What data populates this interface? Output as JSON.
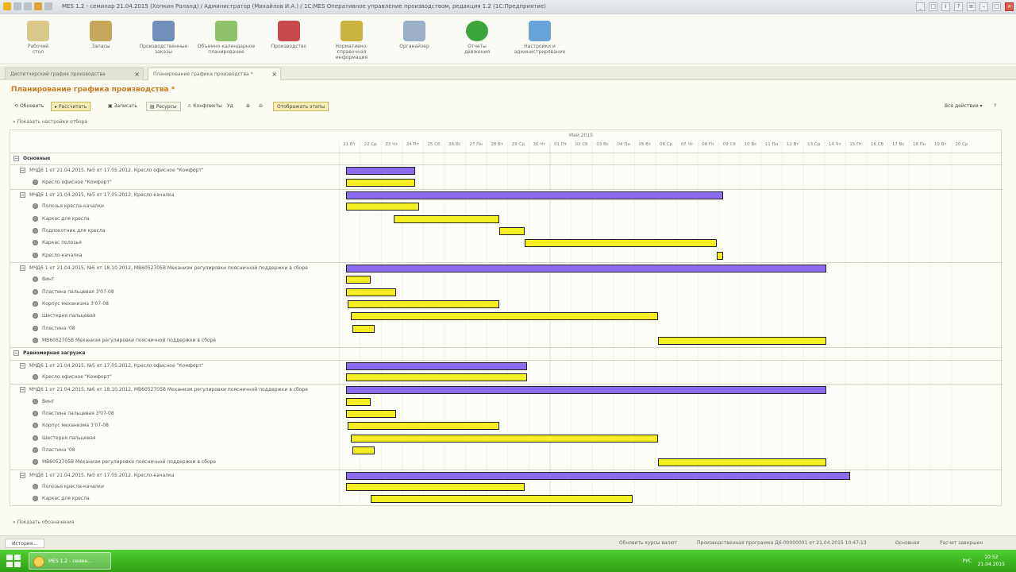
{
  "window": {
    "title": "MES 1.2 - семинар 21.04.2015 (Хопкин Роланд) / Администратор (Михайлов И.А.) / 1С:MES Оперативное управление производством, редакция 1.2 (1С:Предприятие)"
  },
  "ribbon": {
    "items": [
      {
        "label1": "Рабочий",
        "label2": "стол",
        "icon": "desktop-icon"
      },
      {
        "label1": "Запасы",
        "label2": "",
        "icon": "stock-icon"
      },
      {
        "label1": "Производственные",
        "label2": "заказы",
        "icon": "orders-icon"
      },
      {
        "label1": "Объемно-календарное",
        "label2": "планирование",
        "icon": "planning-icon"
      },
      {
        "label1": "Производство",
        "label2": "",
        "icon": "production-icon"
      },
      {
        "label1": "Нормативно-справочная",
        "label2": "информация",
        "icon": "reference-icon"
      },
      {
        "label1": "Органайзер",
        "label2": "",
        "icon": "organizer-icon"
      },
      {
        "label1": "Отчеты",
        "label2": "движения",
        "icon": "reports-icon"
      },
      {
        "label1": "Настройки и",
        "label2": "администрирование",
        "icon": "settings-icon"
      }
    ]
  },
  "tabs": [
    {
      "label": "Диспетчерский график производства",
      "active": false
    },
    {
      "label": "Планирование графика производства *",
      "active": true
    }
  ],
  "page": {
    "title": "Планирование графика производства *",
    "settings_link": "Показать настройки отбора",
    "bottom_link": "Показать обозначения"
  },
  "toolbar": {
    "refresh": "Обновить",
    "calculate": "Рассчитать",
    "save": "Записать",
    "resources": "Ресурсы",
    "conflicts": "Конфликты",
    "depth": "Уд",
    "show_stages": "Отображать этапы",
    "all_actions": "Все действия"
  },
  "timeline": {
    "month": "Май 2015",
    "days": [
      "21 Вт",
      "22 Ср",
      "23 Чт",
      "24 Пт",
      "25 Сб",
      "26 Вс",
      "27 Пн",
      "28 Вт",
      "29 Ср",
      "30 Чт",
      "01 Пт",
      "02 Сб",
      "03 Вс",
      "04 Пн",
      "05 Вт",
      "06 Ср",
      "07 Чт",
      "08 Пт",
      "09 Сб",
      "10 Вс",
      "11 Пн",
      "12 Вт",
      "13 Ср",
      "14 Чт",
      "15 Пт",
      "16 Сб",
      "17 Вс",
      "18 Пн",
      "19 Вт",
      "20 Ср"
    ]
  },
  "rows": [
    {
      "level": 0,
      "kind": "group",
      "label": "Основные",
      "bar": null
    },
    {
      "level": 1,
      "kind": "order",
      "label": "МЧД6 1 от 21.04.2015, №5 от 17.05.2012, Кресло офисное \"Комфорт\"",
      "bar": {
        "color": "purple",
        "start": 0.35,
        "end": 3.6
      }
    },
    {
      "level": 2,
      "kind": "item",
      "label": "Кресло офисное \"Комфорт\"",
      "bar": {
        "color": "yellow",
        "start": 0.35,
        "end": 3.6
      }
    },
    {
      "level": 1,
      "kind": "order",
      "label": "МЧД6 1 от 21.04.2015, №5 от 17.05.2012, Кресло-качалка",
      "bar": {
        "color": "purple",
        "start": 0.35,
        "end": 18.2
      }
    },
    {
      "level": 2,
      "kind": "item",
      "label": "Полозья кресла-качалки",
      "bar": {
        "color": "yellow",
        "start": 0.35,
        "end": 3.8
      }
    },
    {
      "level": 2,
      "kind": "item",
      "label": "Каркас для кресла",
      "bar": {
        "color": "yellow",
        "start": 2.6,
        "end": 7.6
      }
    },
    {
      "level": 2,
      "kind": "item",
      "label": "Подлокотник для кресла",
      "bar": {
        "color": "yellow",
        "start": 7.6,
        "end": 8.8
      }
    },
    {
      "level": 2,
      "kind": "item",
      "label": "Каркас полозья",
      "bar": {
        "color": "yellow",
        "start": 8.8,
        "end": 17.9
      }
    },
    {
      "level": 2,
      "kind": "item",
      "label": "Кресло-качалка",
      "bar": {
        "color": "yellow",
        "start": 17.9,
        "end": 18.2
      }
    },
    {
      "level": 1,
      "kind": "order",
      "label": "МЧД6 1 от 21.04.2015, №6 от 18.10.2012, МВ6052705В Механизм регулировки поясничной поддержки в сборе",
      "bar": {
        "color": "purple",
        "start": 0.35,
        "end": 23.1
      }
    },
    {
      "level": 2,
      "kind": "item",
      "label": "Винт",
      "bar": {
        "color": "yellow",
        "start": 0.35,
        "end": 1.5
      }
    },
    {
      "level": 2,
      "kind": "item",
      "label": "Пластина пальцевая 3'07-08",
      "bar": {
        "color": "yellow",
        "start": 0.35,
        "end": 2.7
      }
    },
    {
      "level": 2,
      "kind": "item",
      "label": "Корпус механизма 3'07-08",
      "bar": {
        "color": "yellow",
        "start": 0.4,
        "end": 7.6
      }
    },
    {
      "level": 2,
      "kind": "item",
      "label": "Шестерня пальцевая",
      "bar": {
        "color": "yellow",
        "start": 0.55,
        "end": 15.1
      }
    },
    {
      "level": 2,
      "kind": "item",
      "label": "Пластина '08",
      "bar": {
        "color": "yellow",
        "start": 0.65,
        "end": 1.7
      }
    },
    {
      "level": 2,
      "kind": "item",
      "label": "МВ6052705В Механизм регулировки поясничной поддержки в сборе",
      "bar": {
        "color": "yellow",
        "start": 15.1,
        "end": 23.1
      }
    },
    {
      "level": 0,
      "kind": "group",
      "label": "Равномерная загрузка",
      "bar": null
    },
    {
      "level": 1,
      "kind": "order",
      "label": "МЧД6 1 от 21.04.2015, №5 от 17.05.2012, Кресло офисное \"Комфорт\"",
      "bar": {
        "color": "purple",
        "start": 0.35,
        "end": 8.9
      }
    },
    {
      "level": 2,
      "kind": "item",
      "label": "Кресло офисное \"Комфорт\"",
      "bar": {
        "color": "yellow",
        "start": 0.35,
        "end": 8.9
      }
    },
    {
      "level": 1,
      "kind": "order",
      "label": "МЧД6 1 от 21.04.2015, №6 от 18.10.2012, МВ6052705В Механизм регулировки поясничной поддержки в сборе",
      "bar": {
        "color": "purple",
        "start": 0.35,
        "end": 23.1
      }
    },
    {
      "level": 2,
      "kind": "item",
      "label": "Винт",
      "bar": {
        "color": "yellow",
        "start": 0.35,
        "end": 1.5
      }
    },
    {
      "level": 2,
      "kind": "item",
      "label": "Пластина пальцевая 3'07-08",
      "bar": {
        "color": "yellow",
        "start": 0.35,
        "end": 2.7
      }
    },
    {
      "level": 2,
      "kind": "item",
      "label": "Корпус механизма 3'07-08",
      "bar": {
        "color": "yellow",
        "start": 0.4,
        "end": 7.6
      }
    },
    {
      "level": 2,
      "kind": "item",
      "label": "Шестерня пальцевая",
      "bar": {
        "color": "yellow",
        "start": 0.55,
        "end": 15.1
      }
    },
    {
      "level": 2,
      "kind": "item",
      "label": "Пластина '08",
      "bar": {
        "color": "yellow",
        "start": 0.65,
        "end": 1.7
      }
    },
    {
      "level": 2,
      "kind": "item",
      "label": "МВ6052705В Механизм регулировки поясничной поддержки в сборе",
      "bar": {
        "color": "yellow",
        "start": 15.1,
        "end": 23.1
      }
    },
    {
      "level": 1,
      "kind": "order",
      "label": "МЧД6 1 от 21.04.2015, №5 от 17.05.2012, Кресло-качалка",
      "bar": {
        "color": "purple",
        "start": 0.35,
        "end": 24.2
      }
    },
    {
      "level": 2,
      "kind": "item",
      "label": "Полозья кресла-качалки",
      "bar": {
        "color": "yellow",
        "start": 0.35,
        "end": 8.8
      }
    },
    {
      "level": 2,
      "kind": "item",
      "label": "Каркас для кресла",
      "bar": {
        "color": "yellow",
        "start": 1.5,
        "end": 13.9
      }
    }
  ],
  "statusbar": {
    "history": "История...",
    "items": [
      "Обновить курсы валют",
      "Производственная программа Д6-00000001 от 21.04.2015 10:47:13",
      "Основная",
      "Расчет завершен"
    ]
  },
  "taskbar": {
    "app_label": "MES 1.2 - семин...",
    "lang": "РУС",
    "time": "10:52",
    "date": "21.04.2015"
  },
  "colors": {
    "order_bar": "#8b6cf0",
    "item_bar": "#f3ef22",
    "title_accent": "#c97a22",
    "taskbar": "#3ab41e"
  }
}
